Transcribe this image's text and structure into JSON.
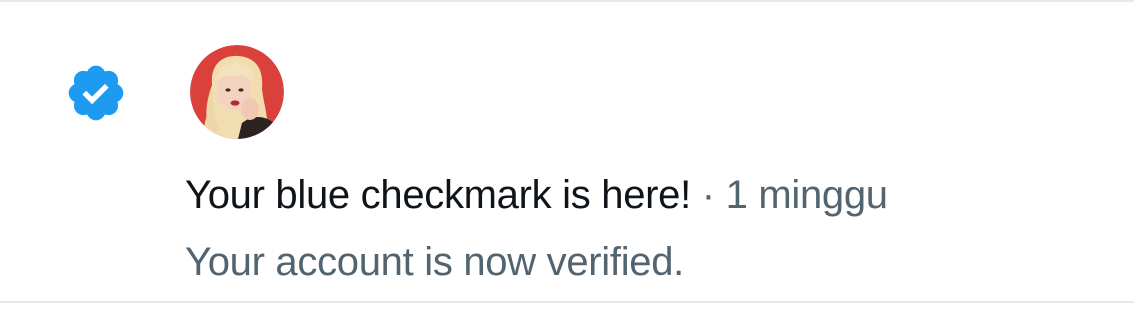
{
  "notification": {
    "badge_icon": "verified-checkmark-icon",
    "avatar": "avatar",
    "title": "Your blue checkmark is here!",
    "separator": " · ",
    "time": "1 minggu",
    "subtitle": "Your account is now verified."
  },
  "colors": {
    "verified_blue": "#1d9bf0",
    "text_primary": "#0f1419",
    "text_secondary": "#536471",
    "divider": "#e6e8ea",
    "avatar_bg": "#d9413a"
  }
}
